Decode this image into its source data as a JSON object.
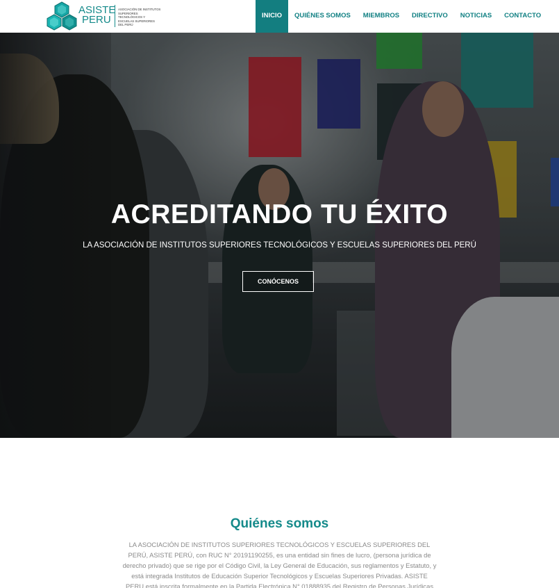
{
  "header": {
    "logo": {
      "name_line1": "ASISTE",
      "name_line2": "PERU",
      "tagline": "ASOCIACIÓN DE INSTITUTOS SUPERIORES TECNOLÓGICOS Y ESCUELAS SUPERIORES DEL PERÚ",
      "colors": {
        "teal": "#148a8a",
        "dark_teal": "#0f6f6e"
      }
    },
    "nav": [
      {
        "label": "INICIO",
        "active": true
      },
      {
        "label": "QUIÉNES SOMOS",
        "active": false
      },
      {
        "label": "MIEMBROS",
        "active": false
      },
      {
        "label": "DIRECTIVO",
        "active": false
      },
      {
        "label": "NOTICIAS",
        "active": false
      },
      {
        "label": "CONTACTO",
        "active": false
      }
    ]
  },
  "hero": {
    "title": "ACREDITANDO TU ÉXITO",
    "subtitle": "LA ASOCIACIÓN DE INSTITUTOS SUPERIORES TECNOLÓGICOS Y ESCUELAS SUPERIORES DEL PERÚ",
    "button_label": "CONÓCENOS",
    "background": "photo of a group of young people talking in an office"
  },
  "about": {
    "title": "Quiénes somos",
    "text": "LA ASOCIACIÓN DE INSTITUTOS SUPERIORES TECNOLÓGICOS Y ESCUELAS SUPERIORES DEL PERÚ, ASISTE PERÚ, con RUC N° 20191190255, es una entidad sin fines de lucro, (persona jurídica de derecho privado) que se rige por el Código Civil, la Ley General de Educación, sus reglamentos y Estatuto, y está integrada Institutos de Educación Superior Tecnológicos y Escuelas Superiores Privadas. ASISTE PERU está inscrita formalmente en la Partida Electrónica N° 01888935 del Registro de Personas Jurídicas de la Oficina Registral de Lima."
  },
  "theme": {
    "accent": "#137e80",
    "text_muted": "#8a8a8a"
  }
}
